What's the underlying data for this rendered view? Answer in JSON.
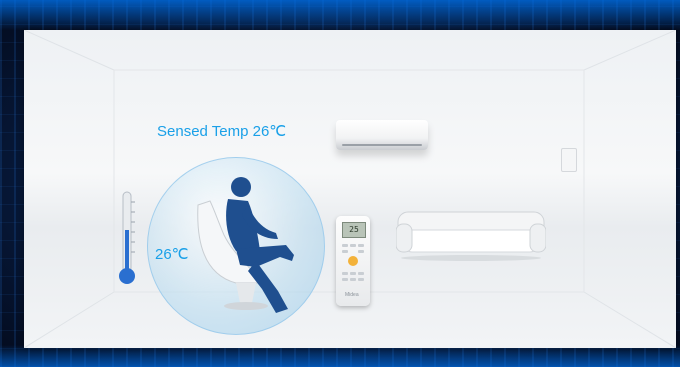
{
  "scene": {
    "sensed_temp_label": "Sensed Temp 26℃",
    "actual_temp_label": "26℃",
    "remote_display": "25",
    "remote_brand": "Midea",
    "colors": {
      "label_blue": "#1aa0e8",
      "frame_blue": "#0d3a7a",
      "bubble_blue": "#8cc3e6",
      "silhouette": "#1f4f8f",
      "thermometer_red": "#2a6fd0"
    },
    "icons": [
      "thermometer-icon",
      "person-silhouette-icon",
      "air-conditioner-icon",
      "remote-control-icon",
      "sofa-icon"
    ]
  }
}
